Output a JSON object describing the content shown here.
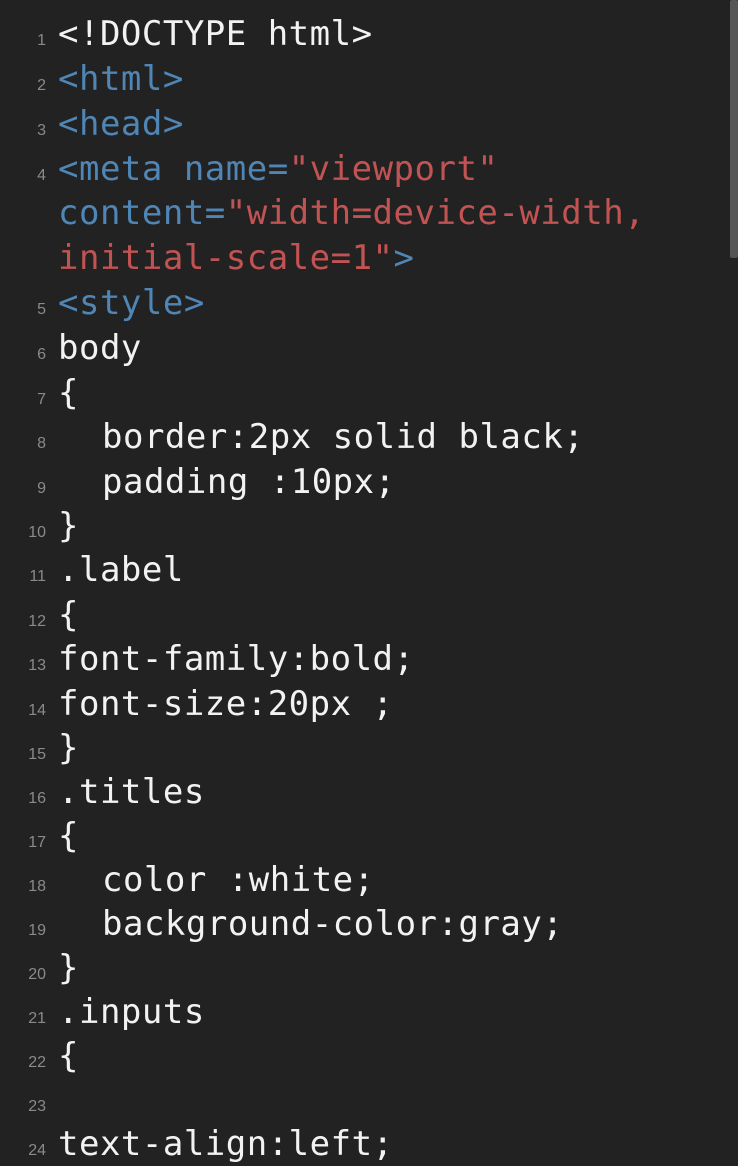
{
  "colors": {
    "background": "#222222",
    "text": "#f2f2f2",
    "tag": "#4f86b5",
    "string": "#c25353",
    "line_number": "#8a8a8a"
  },
  "lines": [
    {
      "num": "1",
      "text": "<!DOCTYPE html>"
    },
    {
      "num": "2",
      "text": "<html>"
    },
    {
      "num": "3",
      "text": "<head>"
    },
    {
      "num": "4",
      "tag_open": "<meta ",
      "attr_name": "name=",
      "attr_value": "\"viewport\""
    },
    {
      "attr_name": "content=",
      "attr_value": "\"width=device-width,"
    },
    {
      "attr_value": "initial-scale=1\"",
      "tag_close": ">"
    },
    {
      "num": "5",
      "text": "<style>"
    },
    {
      "num": "6",
      "text": "body"
    },
    {
      "num": "7",
      "text": "{"
    },
    {
      "num": "8",
      "text": "border:2px solid black;"
    },
    {
      "num": "9",
      "text": "padding :10px;"
    },
    {
      "num": "10",
      "text": "}"
    },
    {
      "num": "11",
      "text": ".label"
    },
    {
      "num": "12",
      "text": "{"
    },
    {
      "num": "13",
      "text": "font-family:bold;"
    },
    {
      "num": "14",
      "text": "font-size:20px ;"
    },
    {
      "num": "15",
      "text": "}"
    },
    {
      "num": "16",
      "text": ".titles"
    },
    {
      "num": "17",
      "text": "{"
    },
    {
      "num": "18",
      "text": "color :white;"
    },
    {
      "num": "19",
      "text": "background-color:gray;"
    },
    {
      "num": "20",
      "text": "}"
    },
    {
      "num": "21",
      "text": ".inputs"
    },
    {
      "num": "22",
      "text": "{"
    },
    {
      "num": "23",
      "text": ""
    },
    {
      "num": "24",
      "text": "text-align:left;"
    }
  ]
}
